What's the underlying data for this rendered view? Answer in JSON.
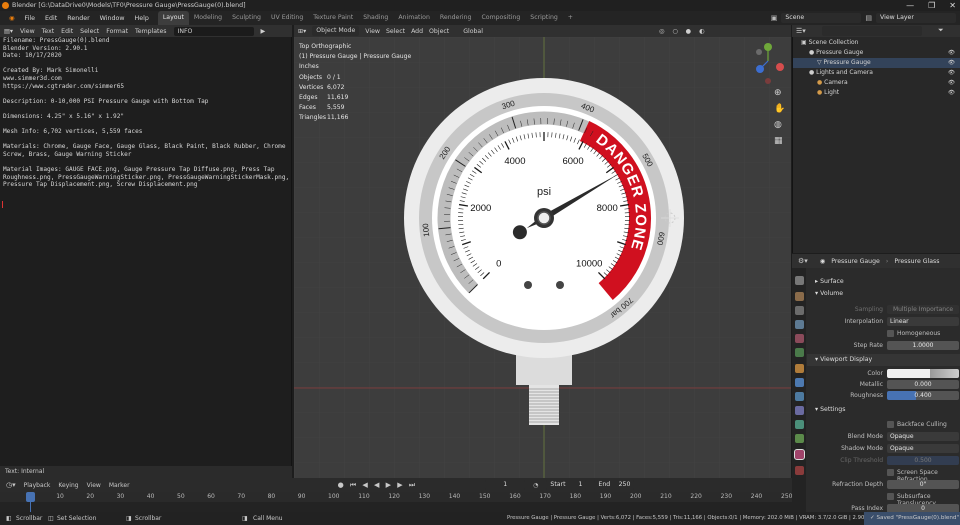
{
  "window": {
    "title": "Blender [G:\\DataDrive0\\Models\\TF0\\Pressure Gauge\\PressGauge(0).blend]",
    "controls": [
      "—",
      "❐",
      "✕"
    ]
  },
  "menu": [
    "File",
    "Edit",
    "Render",
    "Window",
    "Help"
  ],
  "workspaces": [
    "Layout",
    "Modeling",
    "Sculpting",
    "UV Editing",
    "Texture Paint",
    "Shading",
    "Animation",
    "Rendering",
    "Compositing",
    "Scripting",
    "+"
  ],
  "active_workspace": "Layout",
  "scene": {
    "scene_label": "Scene",
    "view_layer_label": "View Layer"
  },
  "text_editor": {
    "menu": [
      "View",
      "Text",
      "Edit",
      "Select",
      "Format",
      "Templates"
    ],
    "text_name": "INFO",
    "lines": [
      "Filename: PressGauge(0).blend",
      "Blender Version: 2.90.1",
      "Date: 10/17/2020",
      "",
      "Created By: Mark Simonelli",
      "www.simmer3d.com",
      "https://www.cgtrader.com/simmer65",
      "",
      "Description: 0-10,000 PSI Pressure Gauge with Bottom Tap",
      "",
      "Dimensions: 4.25\" x 5.16\" x 1.92\"",
      "",
      "Mesh Info: 6,702 vertices, 5,559 faces",
      "",
      "Materials: Chrome, Gauge Face, Gauge Glass, Black Paint, Black Rubber, Chrome",
      "Screw, Brass, Gauge Warning Sticker",
      "",
      "Material Images: GAUGE FACE.png, Gauge Pressure Tap Diffuse.png, Press Tap",
      "Roughness.png, PressGaugeWarningSticker.png, PressGaugeWarningStickerMask.png,",
      "Pressure Tap Displacement.png, Screw Displacement.png"
    ],
    "footer": "Text: Internal"
  },
  "viewport": {
    "menu": [
      "Object Mode",
      "View",
      "Select",
      "Add",
      "Object"
    ],
    "orientation": "Global",
    "view_name": "Top Orthographic",
    "collection": "(1) Pressure Gauge | Pressure Gauge",
    "units": "Inches",
    "stats": [
      {
        "k": "Objects",
        "v": "0 / 1"
      },
      {
        "k": "Vertices",
        "v": "6,072"
      },
      {
        "k": "Edges",
        "v": "11,619"
      },
      {
        "k": "Faces",
        "v": "5,559"
      },
      {
        "k": "Triangles",
        "v": "11,166"
      }
    ],
    "gauge": {
      "psi_labels": [
        "0",
        "2000",
        "4000",
        "6000",
        "8000",
        "10000"
      ],
      "bar_labels": [
        "100",
        "200",
        "300",
        "400",
        "500",
        "600",
        "700 bar"
      ],
      "unit": "psi",
      "warning": "DANGER ZONE",
      "needle_value_psi": 7200
    }
  },
  "outliner": {
    "items": [
      {
        "label": "Scene Collection",
        "indent": 0
      },
      {
        "label": "Pressure Gauge",
        "indent": 1
      },
      {
        "label": "Pressure Gauge",
        "indent": 2
      },
      {
        "label": "Lights and Camera",
        "indent": 1
      },
      {
        "label": "Camera",
        "indent": 2
      },
      {
        "label": "Light",
        "indent": 2
      }
    ]
  },
  "properties": {
    "object": "Pressure Gauge",
    "material": "Pressure Glass",
    "sections": {
      "surface": "Surface",
      "volume": "Volume",
      "viewport_display": "Viewport Display",
      "settings": "Settings"
    },
    "sampling": {
      "label": "Sampling",
      "value": "Multiple Importance"
    },
    "interpolation": {
      "label": "Interpolation",
      "value": "Linear"
    },
    "homogeneous": "Homogeneous",
    "step_rate": {
      "label": "Step Rate",
      "value": "1.0000"
    },
    "color": {
      "label": "Color"
    },
    "metallic": {
      "label": "Metallic",
      "value": "0.000"
    },
    "roughness": {
      "label": "Roughness",
      "value": "0.400"
    },
    "backface": "Backface Culling",
    "blend_mode": {
      "label": "Blend Mode",
      "value": "Opaque"
    },
    "shadow_mode": {
      "label": "Shadow Mode",
      "value": "Opaque"
    },
    "clip": {
      "label": "Clip Threshold",
      "value": "0.500"
    },
    "ssr": "Screen Space Refraction",
    "refraction_depth": {
      "label": "Refraction Depth",
      "value": "0\""
    },
    "subsurface": "Subsurface Translucency",
    "pass_index": {
      "label": "Pass Index",
      "value": "0"
    }
  },
  "timeline": {
    "menu": [
      "Playback",
      "Keying",
      "View",
      "Marker"
    ],
    "current_frame": "1",
    "start_label": "Start",
    "start": "1",
    "end_label": "End",
    "end": "250",
    "ticks": [
      "0",
      "10",
      "20",
      "30",
      "40",
      "50",
      "60",
      "70",
      "80",
      "90",
      "100",
      "110",
      "120",
      "130",
      "140",
      "150",
      "160",
      "170",
      "180",
      "190",
      "200",
      "210",
      "220",
      "230",
      "240",
      "250"
    ]
  },
  "status": {
    "left": [
      "Scrollbar",
      "Set Selection",
      "Scrollbar",
      "Call Menu"
    ],
    "right": "Pressure Gauge | Pressure Gauge | Verts:6,072 | Faces:5,559 | Tris:11,166 | Objects:0/1 | Memory: 202.0 MiB | VRAM: 3.7/2.0 GiB | 2.90.1",
    "saved": "Saved \"PressGauge(0).blend\""
  }
}
